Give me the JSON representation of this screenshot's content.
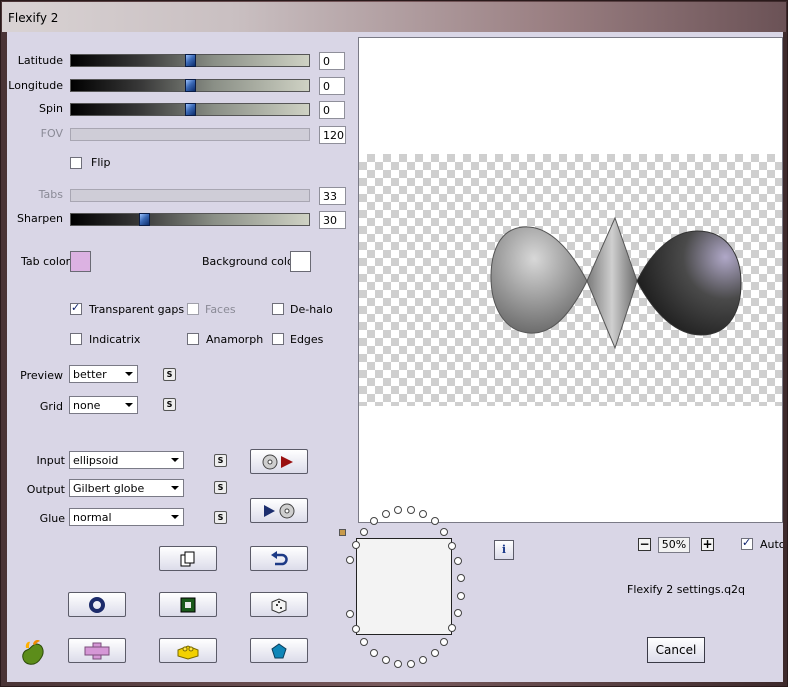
{
  "window": {
    "title": "Flexify 2"
  },
  "sliders": [
    {
      "label": "Latitude",
      "value": "0",
      "thumb_fraction": 0.5
    },
    {
      "label": "Longitude",
      "value": "0",
      "thumb_fraction": 0.5
    },
    {
      "label": "Spin",
      "value": "0",
      "thumb_fraction": 0.5
    },
    {
      "label": "FOV",
      "value": "120",
      "disabled": true
    },
    {
      "label": "Tabs",
      "value": "33",
      "disabled": true
    },
    {
      "label": "Sharpen",
      "value": "30",
      "thumb_fraction": 0.3
    }
  ],
  "flip": {
    "label": "Flip",
    "checked": false
  },
  "colors": {
    "tab_label": "Tab color",
    "tab_hex": "#dcb2e2",
    "bg_label": "Background color",
    "bg_hex": "#ffffff"
  },
  "options": [
    {
      "label": "Transparent gaps",
      "checked": true
    },
    {
      "label": "Faces",
      "checked": false,
      "disabled": true
    },
    {
      "label": "De-halo",
      "checked": false
    },
    {
      "label": "Indicatrix",
      "checked": false
    },
    {
      "label": "Anamorph",
      "checked": false
    },
    {
      "label": "Edges",
      "checked": false
    }
  ],
  "dropdowns": {
    "preview": {
      "label": "Preview",
      "value": "better"
    },
    "grid": {
      "label": "Grid",
      "value": "none"
    },
    "input": {
      "label": "Input",
      "value": "ellipsoid"
    },
    "output": {
      "label": "Output",
      "value": "Gilbert globe"
    },
    "glue": {
      "label": "Glue",
      "value": "normal"
    }
  },
  "s_button_label": "S",
  "zoom": {
    "value": "50%",
    "minus": "−",
    "plus": "+",
    "auto_label": "Auto",
    "auto_checked": true
  },
  "settings_file": "Flexify 2 settings.q2q",
  "info_label": "i",
  "cancel_label": "Cancel"
}
